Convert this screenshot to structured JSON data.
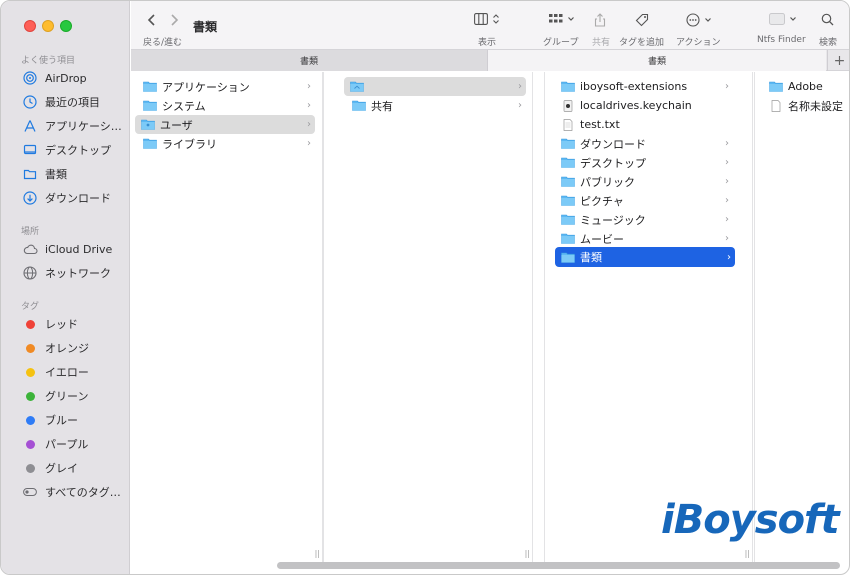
{
  "window": {
    "title": "書類",
    "nav_label": "戻る/進む"
  },
  "sidebar": {
    "favorites_title": "よく使う項目",
    "favorites": [
      {
        "label": "AirDrop",
        "icon": "airdrop-icon"
      },
      {
        "label": "最近の項目",
        "icon": "clock-icon"
      },
      {
        "label": "アプリケーシ…",
        "icon": "applications-icon"
      },
      {
        "label": "デスクトップ",
        "icon": "desktop-icon"
      },
      {
        "label": "書類",
        "icon": "document-folder-icon"
      },
      {
        "label": "ダウンロード",
        "icon": "download-icon"
      }
    ],
    "locations_title": "場所",
    "locations": [
      {
        "label": "iCloud Drive",
        "icon": "cloud-icon"
      },
      {
        "label": "ネットワーク",
        "icon": "globe-icon"
      }
    ],
    "tags_title": "タグ",
    "tags": [
      {
        "label": "レッド",
        "color": "#ef4238"
      },
      {
        "label": "オレンジ",
        "color": "#f08a24"
      },
      {
        "label": "イエロー",
        "color": "#f5c211"
      },
      {
        "label": "グリーン",
        "color": "#3cb33a"
      },
      {
        "label": "ブルー",
        "color": "#2f7cf6"
      },
      {
        "label": "パープル",
        "color": "#a550d4"
      },
      {
        "label": "グレイ",
        "color": "#8e8e93"
      },
      {
        "label": "すべてのタグ…",
        "color": ""
      }
    ]
  },
  "toolbar": {
    "view_label": "表示",
    "group_label": "グループ",
    "share_label": "共有",
    "tag_label": "タグを追加",
    "action_label": "アクション",
    "ntfs_label": "Ntfs Finder",
    "search_label": "検索"
  },
  "tabs": [
    {
      "label": "書類"
    },
    {
      "label": "書類"
    }
  ],
  "columns": {
    "col1": [
      {
        "label": "アプリケーション"
      },
      {
        "label": "システム"
      },
      {
        "label": "ユーザ"
      },
      {
        "label": "ライブラリ"
      }
    ],
    "col2": [
      {
        "label": ""
      },
      {
        "label": "共有"
      }
    ],
    "col3": [
      {
        "label": "iboysoft-extensions"
      },
      {
        "label": "localdrives.keychain"
      },
      {
        "label": "test.txt"
      },
      {
        "label": "ダウンロード"
      },
      {
        "label": "デスクトップ"
      },
      {
        "label": "パブリック"
      },
      {
        "label": "ピクチャ"
      },
      {
        "label": "ミュージック"
      },
      {
        "label": "ムービー"
      },
      {
        "label": "書類"
      }
    ],
    "col4": [
      {
        "label": "Adobe"
      },
      {
        "label": "名称未設定"
      }
    ]
  },
  "watermark": "iBoysoft"
}
